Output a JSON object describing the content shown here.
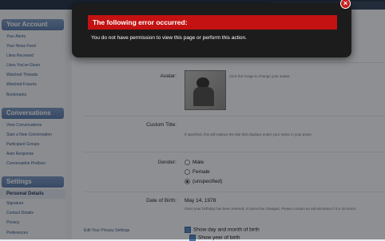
{
  "sidebar": {
    "account_header": "Your Account",
    "account_items": [
      "Your Alerts",
      "Your News Feed",
      "Likes Received",
      "Likes You've Given",
      "Watched Threads",
      "Watched Forums",
      "Bookmarks"
    ],
    "conversations_header": "Conversations",
    "conversation_items": [
      "View Conversations",
      "Start a New Conversation",
      "Participant Groups",
      "Auto Response",
      "Conversation Prefixes"
    ],
    "settings_header": "Settings",
    "settings_items": [
      "Personal Details",
      "Signature",
      "Contact Details",
      "Privacy",
      "Preferences"
    ]
  },
  "form": {
    "avatar_label": "Avatar:",
    "avatar_hint": "Click the image to change your avatar.",
    "custom_title_label": "Custom Title:",
    "custom_title_hint": "If specified, this will replace the title that displays under your name in your posts.",
    "gender_label": "Gender:",
    "gender_options": [
      "Male",
      "Female",
      "(unspecified)"
    ],
    "gender_selected": "(unspecified)",
    "dob_label": "Date of Birth:",
    "dob_value": "May 14, 1978",
    "dob_hint": "Once your birthday has been entered, it cannot be changed. Please contact an administrator if it is incorrect.",
    "privacy_link": "Edit Your Privacy Settings",
    "show_dob": "Show day and month of birth",
    "show_year": "Show year of birth"
  },
  "error_dialog": {
    "title": "The following error occurred:",
    "message": "You do not have permission to view this page or perform this action.",
    "close_symbol": "×"
  }
}
